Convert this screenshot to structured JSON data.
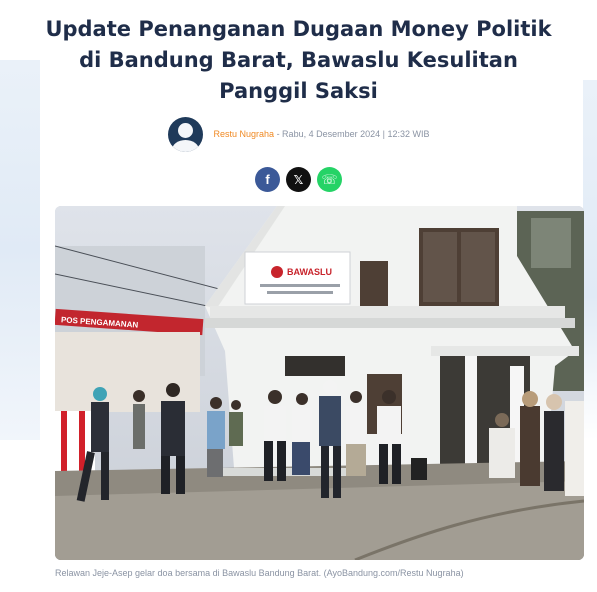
{
  "article": {
    "title": "Update Penanganan Dugaan Money Politik di Bandung Barat, Bawaslu Kesulitan Panggil Saksi",
    "author": "Restu Nugraha",
    "date": " - Rabu, 4 Desember 2024 | 12:32 WIB",
    "caption": "Relawan Jeje-Asep gelar doa bersama di Bawaslu Bandung Barat. (AyoBandung.com/Restu Nugraha)"
  },
  "share": {
    "facebook": "f",
    "x": "𝕏",
    "whatsapp": "☏"
  },
  "photo": {
    "sign_title": "BAWASLU",
    "banner_text": "POS PENGAMANAN"
  },
  "colors": {
    "title": "#1f2d49",
    "author": "#f08a24",
    "meta": "#8a93a3",
    "facebook": "#3b5998",
    "x": "#111111",
    "whatsapp": "#25d366"
  }
}
